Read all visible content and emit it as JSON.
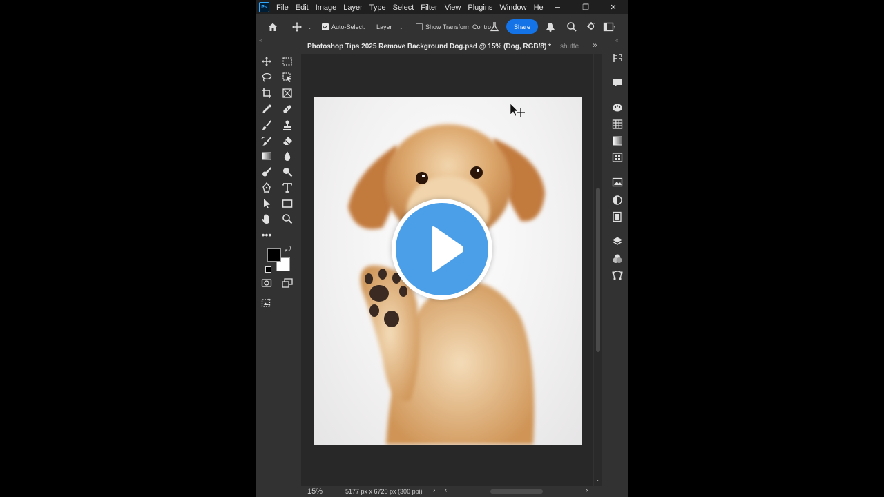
{
  "app": {
    "logo_text": "Ps",
    "menu": [
      "File",
      "Edit",
      "Image",
      "Layer",
      "Type",
      "Select",
      "Filter",
      "View",
      "Plugins",
      "Window",
      "He"
    ],
    "window_controls": {
      "minimize": "─",
      "restore": "❐",
      "close": "✕"
    }
  },
  "options_bar": {
    "auto_select_label": "Auto-Select:",
    "auto_select_checked": true,
    "target_value": "Layer",
    "show_transform_label": "Show Transform Contro",
    "show_transform_checked": false,
    "share_label": "Share",
    "accent_color": "#1473e6"
  },
  "tabs": {
    "active": "Photoshop Tips 2025 Remove Background Dog.psd @ 15% (Dog, RGB/8) *",
    "active_close": "✕",
    "inactive": "shutte",
    "more": "»"
  },
  "toolbar": {
    "collapse": "«",
    "tools": [
      "move-tool",
      "marquee-tool",
      "lasso-tool",
      "object-select-tool",
      "crop-tool",
      "frame-tool",
      "eyedropper-tool",
      "healing-brush-tool",
      "brush-tool",
      "clone-stamp-tool",
      "history-brush-tool",
      "eraser-tool",
      "gradient-tool",
      "blur-tool",
      "dodge-tool",
      "pen-tool",
      "type-tool",
      "path-select-tool",
      "rectangle-tool",
      "hand-tool",
      "zoom-tool",
      "more-tools",
      "quick-mask",
      "screen-mode",
      "generative-fill"
    ],
    "foreground_color": "#000000",
    "background_color": "#ffffff"
  },
  "status": {
    "zoom": "15%",
    "doc_size": "5177 px x 6720 px (300 ppi)",
    "arrow": "›",
    "scroll_left": "‹",
    "scroll_right": "›"
  },
  "right_panel": {
    "collapse": "«",
    "icons": [
      "history-icon",
      "comments-icon",
      "color-palette-icon",
      "swatches-icon",
      "gradients-icon",
      "patterns-icon",
      "image-icon",
      "adjustments-icon",
      "libraries-icon",
      "layers-icon",
      "channels-icon",
      "paths-icon"
    ]
  },
  "overlay": {
    "play_button_color": "#4a9fe8"
  }
}
